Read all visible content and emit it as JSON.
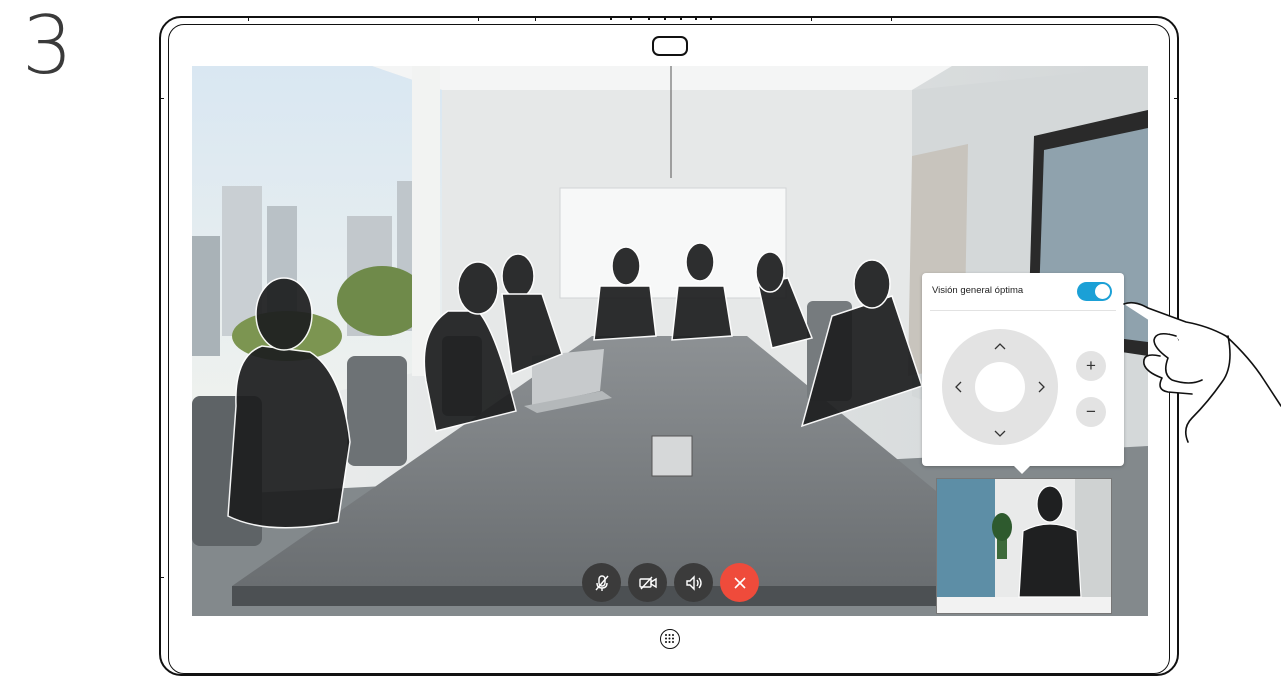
{
  "step": {
    "number": "3"
  },
  "camera_panel": {
    "title": "Visión general óptima",
    "toggle_on": true,
    "accent_color": "#1ba0d6",
    "dpad": {
      "up_glyph": "^",
      "down_glyph": "v",
      "left_glyph": "<",
      "right_glyph": ">"
    },
    "zoom_in_label": "+",
    "zoom_out_label": "−"
  },
  "call_controls": [
    {
      "icon": "mic-muted-icon"
    },
    {
      "icon": "video-off-icon"
    },
    {
      "icon": "speaker-icon"
    },
    {
      "icon": "end-call-icon",
      "color": "#ef4b3b"
    }
  ],
  "device": {
    "camera_icon": "camera-pill-icon",
    "keypad_icon": "keypad-icon"
  }
}
